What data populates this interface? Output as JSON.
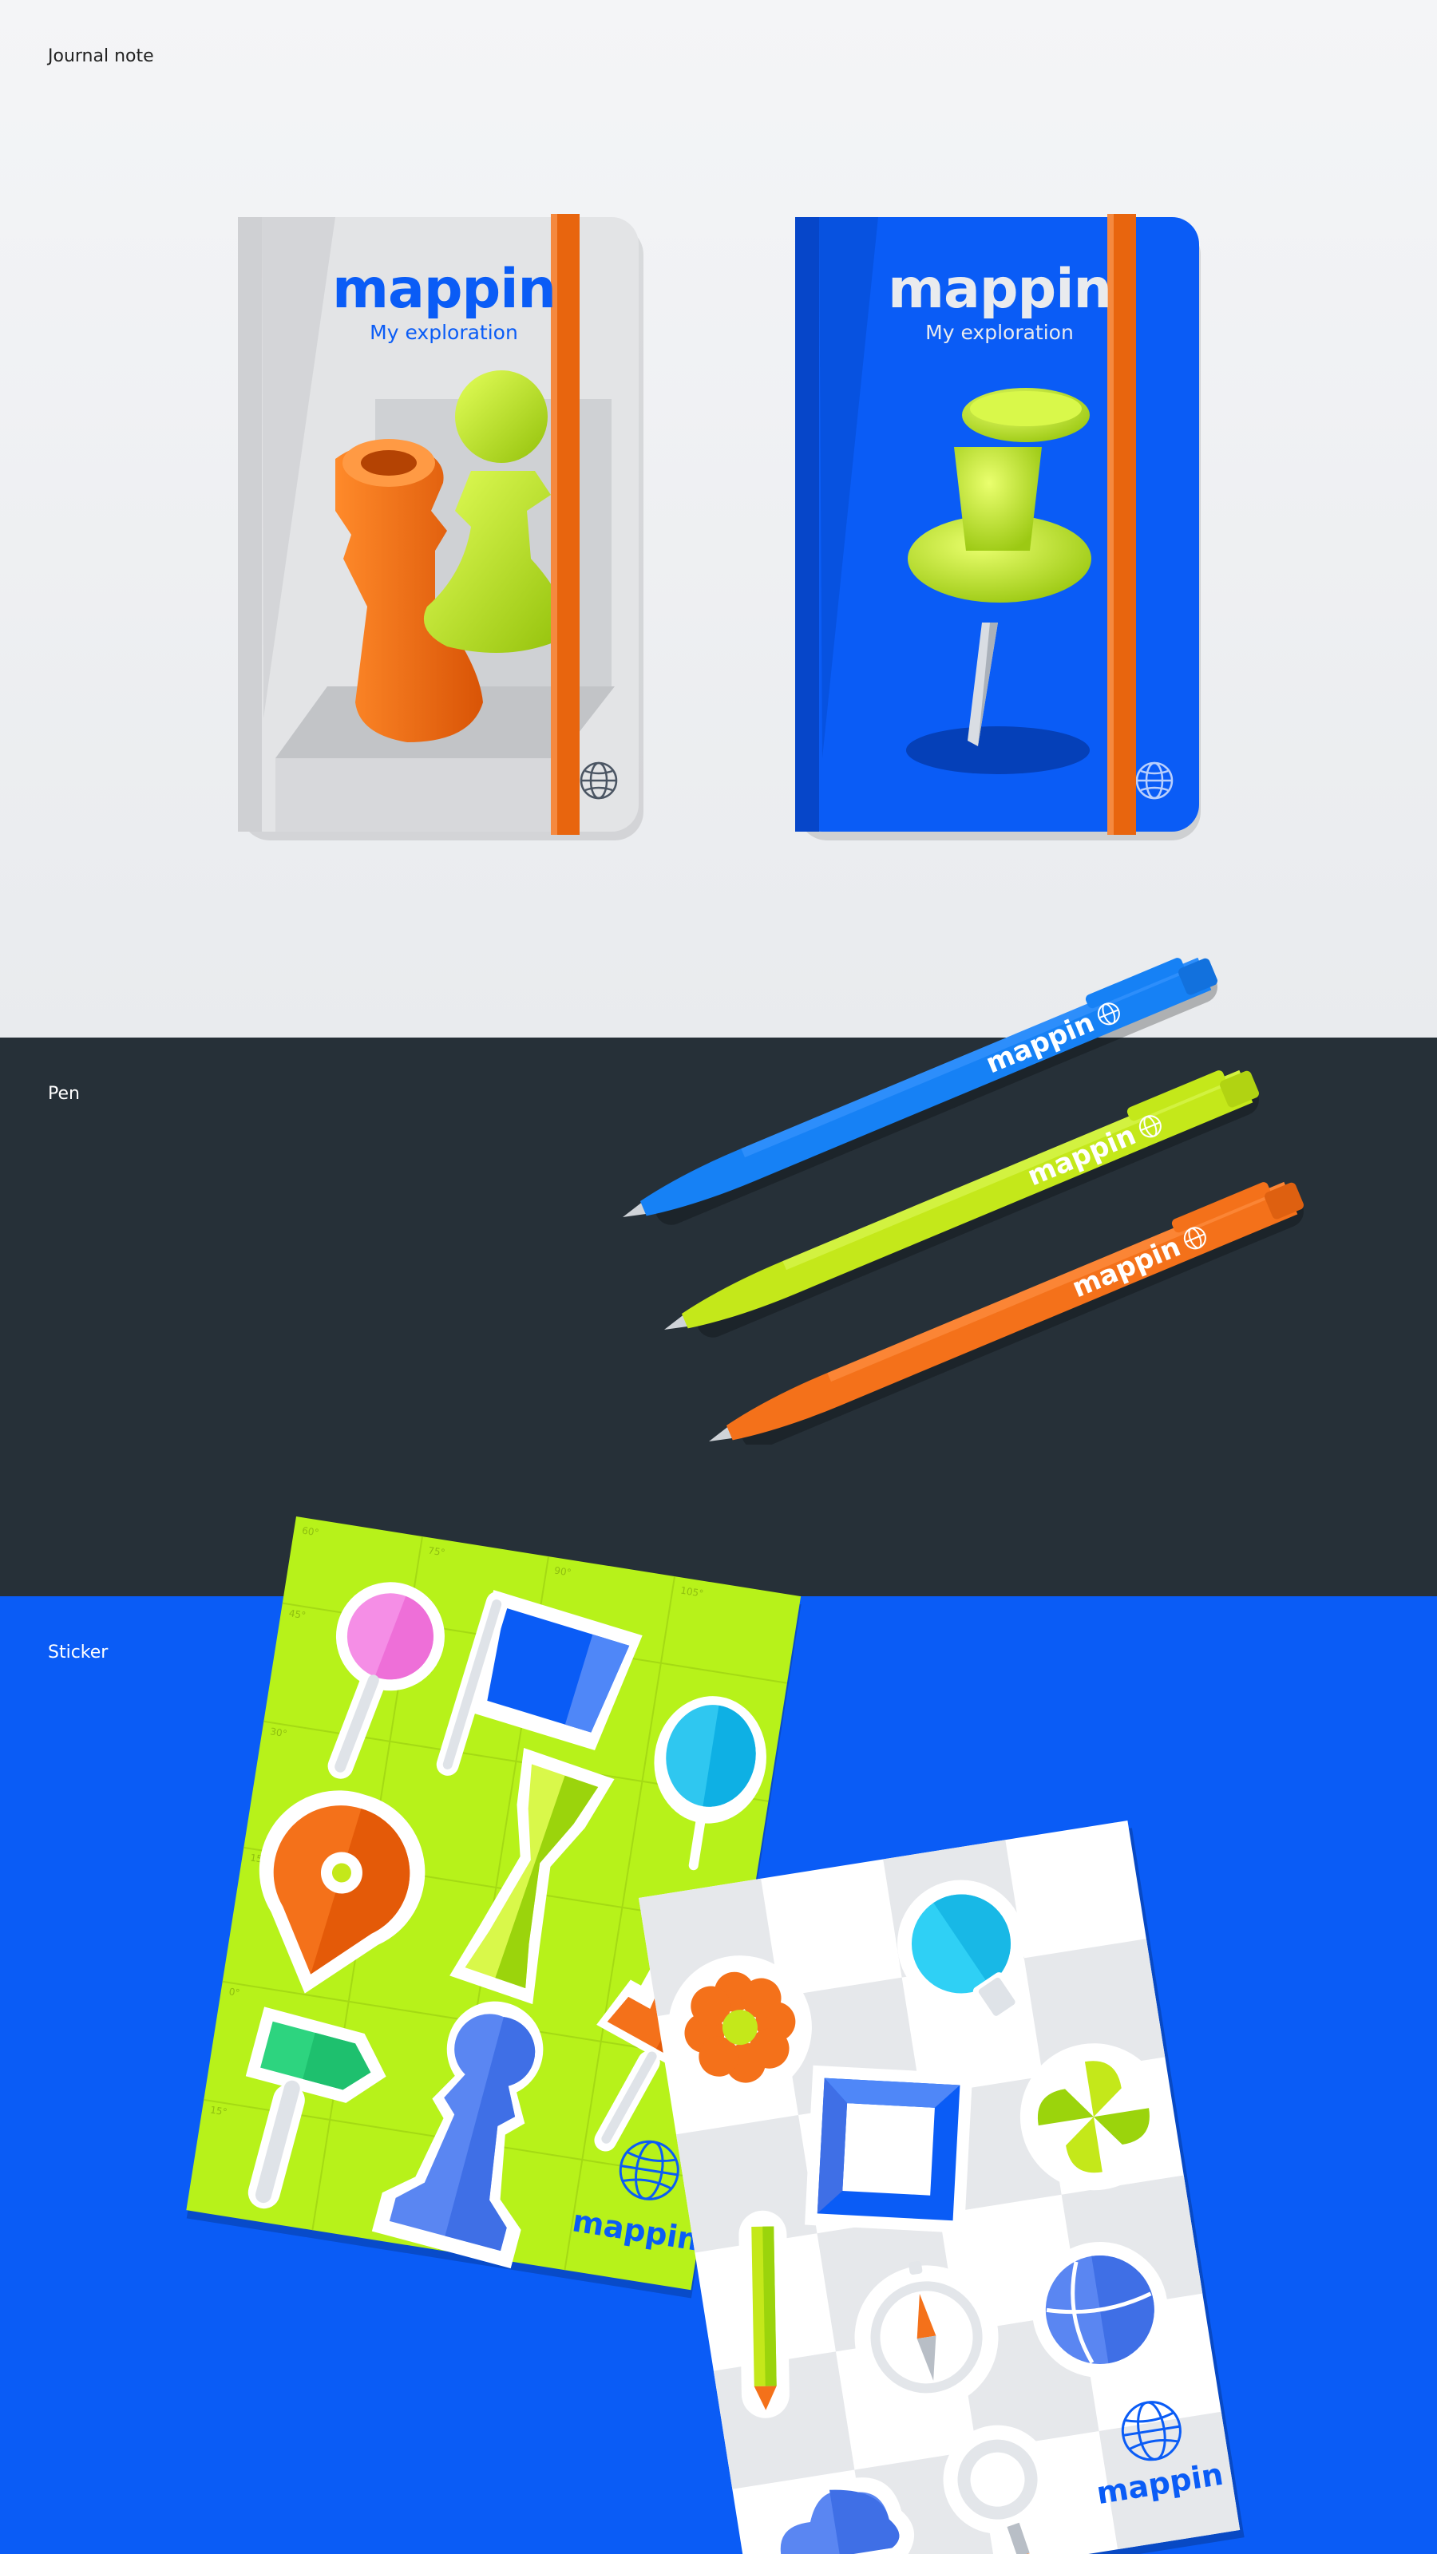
{
  "sections": {
    "journal": {
      "label": "Journal note"
    },
    "pen": {
      "label": "Pen"
    },
    "sticker": {
      "label": "Sticker"
    }
  },
  "brand": {
    "name": "mappin",
    "tagline": "My exploration"
  },
  "colors": {
    "brand_blue": "#0a5cf6",
    "lime": "#c4e81a",
    "orange": "#f4711a",
    "dark": "#263038",
    "light_gray": "#e9ebee",
    "elastic_band": "#e8650e"
  },
  "notebooks": [
    {
      "cover": "light-gray",
      "illustration": "chess-rook-and-pawn"
    },
    {
      "cover": "blue",
      "illustration": "push-pin"
    }
  ],
  "pens": [
    {
      "color": "blue"
    },
    {
      "color": "lime"
    },
    {
      "color": "orange"
    }
  ],
  "sticker_sheets": [
    {
      "background": "lime",
      "stickers": [
        "lollipop-pin-icon",
        "flag-icon",
        "balloon-pin-icon",
        "map-marker-icon",
        "bone-tool-icon",
        "signpost-icon",
        "pawn-icon",
        "push-pin-icon",
        "globe-logo-icon"
      ],
      "grid_labels": [
        "60°",
        "75°",
        "90°",
        "105°",
        "45°",
        "30°",
        "15°",
        "0°",
        "15°"
      ]
    },
    {
      "background": "white-checker",
      "stickers": [
        "flower-icon",
        "lightbulb-icon",
        "frame-icon",
        "pinwheel-icon",
        "pencil-icon",
        "compass-icon",
        "globe-icon",
        "cloud-icon",
        "magnifier-icon",
        "globe-logo-icon"
      ]
    }
  ]
}
